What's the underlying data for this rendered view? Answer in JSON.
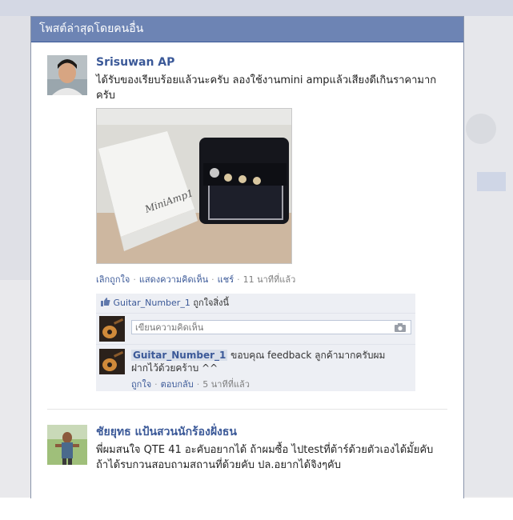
{
  "dialog": {
    "title": "โพสต์ล่าสุดโดยคนอื่น"
  },
  "posts": [
    {
      "author": "Srisuwan AP",
      "message": "ได้รับของเรียบร้อยแล้วนะครับ ลองใช้งานmini ampแล้วเสียงดีเกินราคามากครับ",
      "photo_caption": "MiniAmp1",
      "actions": {
        "unlike": "เลิกถูกใจ",
        "show_comments": "แสดงความคิดเห็น",
        "share": "แชร์",
        "time": "11 นาทีที่แล้ว"
      },
      "likes": {
        "liker": "Guitar_Number_1",
        "text": "ถูกใจสิ่งนี้"
      },
      "comment_input": {
        "placeholder": "เขียนความคิดเห็น"
      },
      "comments": [
        {
          "author": "Guitar_Number_1",
          "text": "ขอบคุณ feedback ลูกค้ามากครับผม ฝากไว้ด้วยคร้าบ ^^",
          "like": "ถูกใจ",
          "reply": "ตอบกลับ",
          "time": "5 นาทีที่แล้ว"
        }
      ]
    },
    {
      "author": "ชัยยุทธ แป้นสวนนักร้องฝั่งธน",
      "message": "พี่ผมสนใจ QTE 41 อะคับอยากได้ ถ้าผมซื้อ ไปtestที่ต้าร์ด้วยตัวเองได้มั้ยคับ ถ้าได้รบกวนสอบถามสถานที่ด้วยคับ ปล.อยากได้จิงๆคับ"
    }
  ],
  "colors": {
    "header_bg": "#6d84b4",
    "link": "#3b5998",
    "ufi_bg": "#edeff4"
  }
}
